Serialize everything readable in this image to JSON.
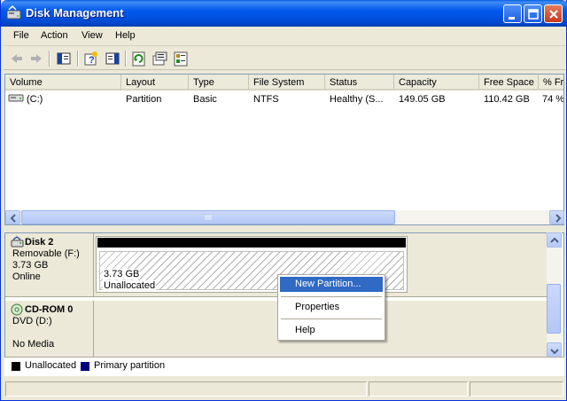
{
  "window": {
    "title": "Disk Management"
  },
  "menubar": {
    "items": [
      {
        "label": "File"
      },
      {
        "label": "Action"
      },
      {
        "label": "View"
      },
      {
        "label": "Help"
      }
    ]
  },
  "listview": {
    "columns": [
      {
        "label": "Volume"
      },
      {
        "label": "Layout"
      },
      {
        "label": "Type"
      },
      {
        "label": "File System"
      },
      {
        "label": "Status"
      },
      {
        "label": "Capacity"
      },
      {
        "label": "Free Space"
      },
      {
        "label": "% Fr"
      }
    ],
    "rows": [
      {
        "volume": "(C:)",
        "layout": "Partition",
        "type": "Basic",
        "file_system": "NTFS",
        "status": "Healthy (S...",
        "capacity": "149.05 GB",
        "free_space": "110.42 GB",
        "percent_free": "74 %"
      }
    ]
  },
  "disks": [
    {
      "name": "Disk 2",
      "type": "Removable (F:)",
      "size": "3.73 GB",
      "state": "Online",
      "partition": {
        "size": "3.73 GB",
        "status": "Unallocated"
      }
    },
    {
      "name": "CD-ROM 0",
      "type": "DVD (D:)",
      "state": "No Media"
    }
  ],
  "legend": [
    {
      "label": "Unallocated",
      "color": "#000000"
    },
    {
      "label": "Primary partition",
      "color": "#00007f"
    }
  ],
  "context_menu": {
    "items": [
      {
        "label": "New Partition...",
        "highlighted": true
      },
      {
        "label": "Properties"
      },
      {
        "label": "Help"
      }
    ]
  },
  "colors": {
    "titlebar": "#0054e3",
    "selection": "#316ac5",
    "unallocated_bar": "#000000"
  }
}
